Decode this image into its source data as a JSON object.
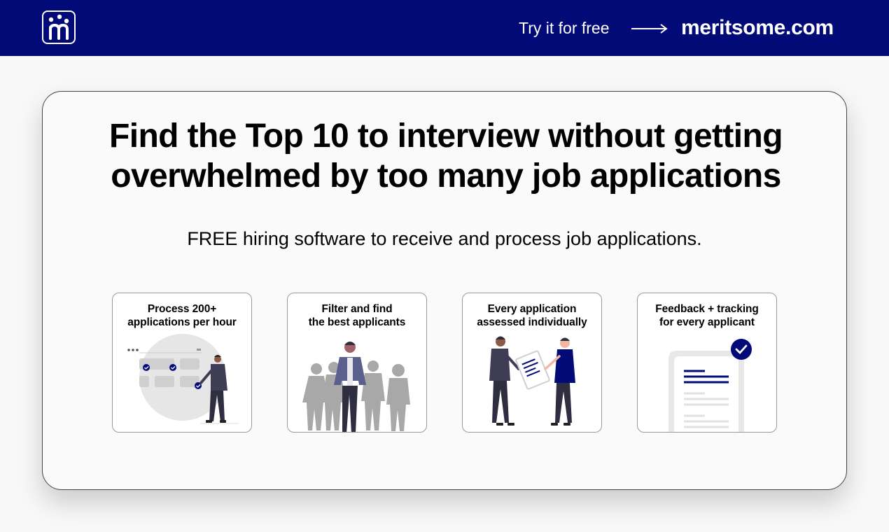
{
  "header": {
    "logo_icon": "meritsome-logo-icon",
    "cta_text": "Try it for free",
    "arrow_icon": "arrow-right-icon",
    "domain": "meritsome.com",
    "bar_color": "#020a78"
  },
  "hero": {
    "headline": "Find the Top 10 to interview without getting overwhelmed by too many job applications",
    "subtitle": "FREE hiring software to receive and process job applications."
  },
  "features": [
    {
      "title": "Process 200+\napplications per hour",
      "illustration": "person-reviewing-board-illustration"
    },
    {
      "title": "Filter and find\nthe best applicants",
      "illustration": "crowd-with-highlighted-person-illustration"
    },
    {
      "title": "Every application\nassessed individually",
      "illustration": "two-people-sharing-document-illustration"
    },
    {
      "title": "Feedback + tracking\nfor every applicant",
      "illustration": "checked-document-illustration"
    }
  ],
  "colors": {
    "accent": "#020a78",
    "text": "#000000",
    "card_border": "#444444"
  }
}
